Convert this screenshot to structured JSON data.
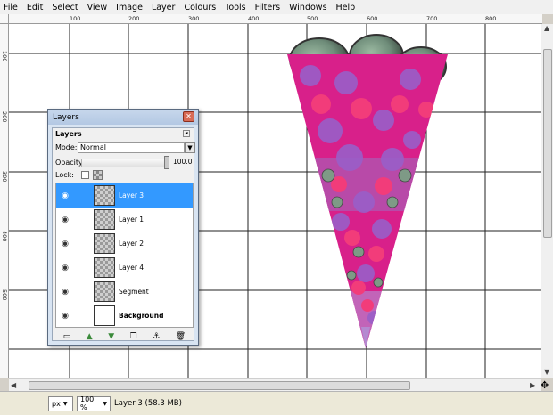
{
  "menubar": {
    "items": [
      "File",
      "Edit",
      "Select",
      "View",
      "Image",
      "Layer",
      "Colours",
      "Tools",
      "Filters",
      "Windows",
      "Help"
    ]
  },
  "ruler": {
    "top_ticks": [
      "100",
      "200",
      "300",
      "400",
      "500",
      "600",
      "700",
      "800"
    ],
    "left_ticks": [
      "0",
      "100",
      "200",
      "300",
      "400",
      "500"
    ]
  },
  "layers_dialog": {
    "title": "Layers",
    "tab_label": "Layers",
    "mode_label": "Mode:",
    "mode_value": "Normal",
    "opacity_label": "Opacity:",
    "opacity_value": "100.0",
    "lock_label": "Lock:",
    "layers": [
      {
        "name": "Layer 3",
        "selected": true,
        "thumb": "checker"
      },
      {
        "name": "Layer 1",
        "selected": false,
        "thumb": "checker"
      },
      {
        "name": "Layer 2",
        "selected": false,
        "thumb": "checker"
      },
      {
        "name": "Layer 4",
        "selected": false,
        "thumb": "checker"
      },
      {
        "name": "Segment",
        "selected": false,
        "thumb": "checker"
      },
      {
        "name": "Background",
        "selected": false,
        "thumb": "white"
      }
    ],
    "toolbar_icons": [
      "new-layer-icon",
      "raise-layer-icon",
      "lower-layer-icon",
      "duplicate-layer-icon",
      "anchor-layer-icon",
      "delete-layer-icon"
    ]
  },
  "statusbar": {
    "unit": "px",
    "zoom": "100 %",
    "layer_info": "Layer 3 (58.3 MB)"
  },
  "colors": {
    "selection_blue": "#3399ff",
    "flower_pink": "#e0207a",
    "flower_purple": "#9a5fc8"
  }
}
